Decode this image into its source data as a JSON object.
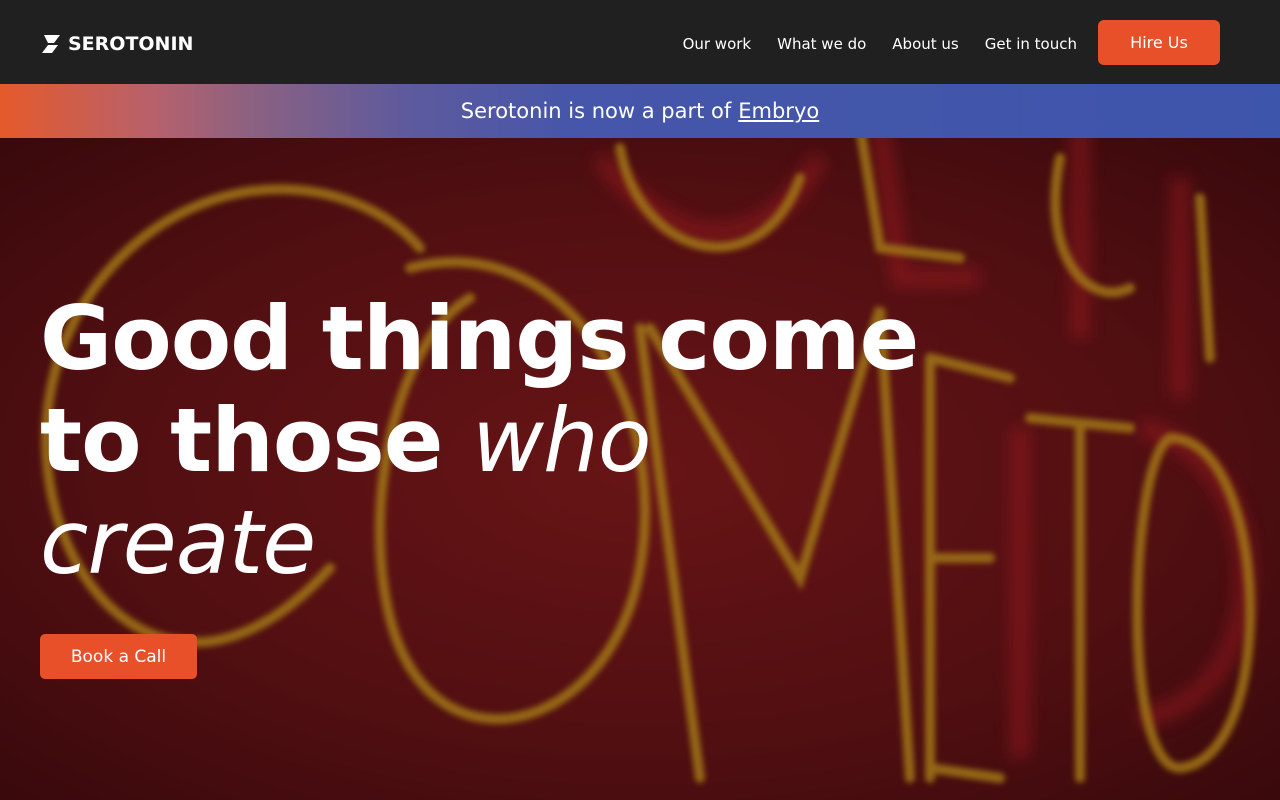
{
  "brand": {
    "logo_icon": "lightning-s-icon",
    "name": "SEROTONIN"
  },
  "nav": {
    "items": [
      {
        "label": "Our work"
      },
      {
        "label": "What we do"
      },
      {
        "label": "About us"
      },
      {
        "label": "Get in touch"
      }
    ],
    "cta_label": "Hire Us"
  },
  "banner": {
    "text": "Serotonin is now a part of",
    "link_label": "Embryo"
  },
  "hero": {
    "headline_line1": "Good things come",
    "headline_line2_bold": "to those ",
    "headline_line2_italic": "who",
    "headline_line3_italic": "create",
    "cta_label": "Book a Call",
    "background": "neon-sign-photo"
  },
  "colors": {
    "accent": "#e8502a",
    "header_bg": "#202020",
    "banner_start": "#e55a2b",
    "banner_end": "#3d55ab"
  }
}
